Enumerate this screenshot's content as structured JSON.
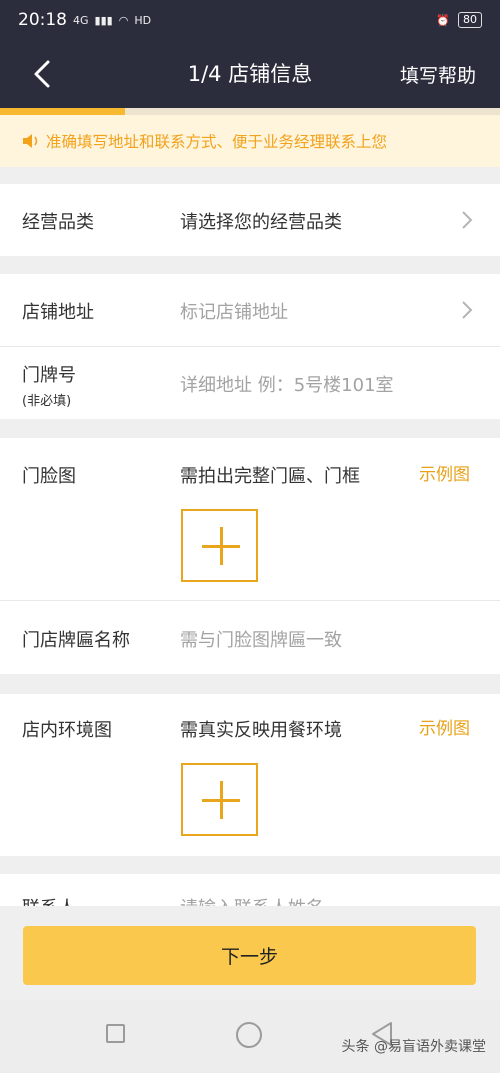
{
  "status_bar": {
    "time": "20:18",
    "signal": "4G",
    "hd": "HD",
    "battery": "80"
  },
  "nav": {
    "title": "1/4 店铺信息",
    "help": "填写帮助"
  },
  "progress": {
    "fraction": 0.25
  },
  "notice": {
    "text": "准确填写地址和联系方式、便于业务经理联系上您"
  },
  "form": {
    "category": {
      "label": "经营品类",
      "placeholder": "请选择您的经营品类"
    },
    "address": {
      "label": "店铺地址",
      "placeholder": "标记店铺地址"
    },
    "house_number": {
      "label": "门牌号",
      "sub": "(非必填)",
      "placeholder": "详细地址 例：5号楼101室"
    },
    "storefront_photo": {
      "label": "门脸图",
      "hint": "需拍出完整门匾、门框",
      "example": "示例图"
    },
    "sign_name": {
      "label": "门店牌匾名称",
      "placeholder": "需与门脸图牌匾一致"
    },
    "interior_photo": {
      "label": "店内环境图",
      "hint": "需真实反映用餐环境",
      "example": "示例图"
    },
    "contact": {
      "label": "联系人",
      "placeholder": "请输入联系人姓名"
    }
  },
  "next_button": {
    "label": "下一步"
  },
  "watermark": "头条 @易盲语外卖课堂",
  "colors": {
    "accent": "#f7b92f",
    "header": "#2b2d3c",
    "notice_text": "#f2a21b"
  }
}
